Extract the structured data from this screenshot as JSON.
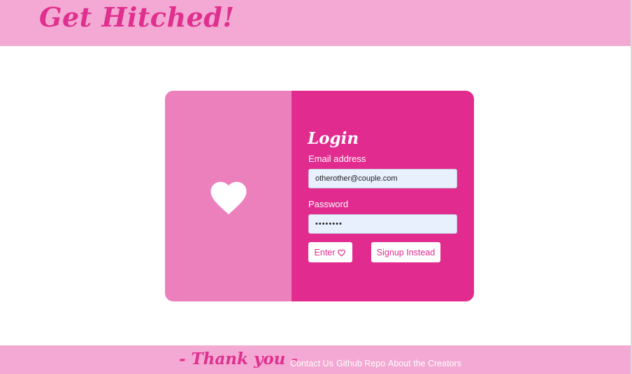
{
  "header": {
    "brand": "Get Hitched!"
  },
  "card": {
    "heart_icon": "heart-icon",
    "title": "Login",
    "email_label": "Email address",
    "email_value": "otherother@couple.com",
    "password_label": "Password",
    "password_value": "••••••••",
    "enter_label": "Enter",
    "signup_label": "Signup Instead"
  },
  "footer": {
    "thanks": "- Thank you -",
    "links": [
      "Contact Us",
      "Github Repo",
      "About the Creators"
    ]
  },
  "colors": {
    "brand_pink": "#e0308f",
    "header_pink": "#f3a9d3",
    "card_left": "#ec80bd",
    "card_right": "#e22b8f"
  }
}
